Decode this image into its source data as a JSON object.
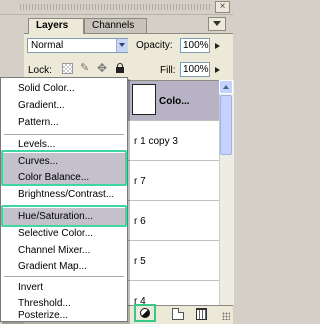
{
  "palette": {
    "close_glyph": "×",
    "tabs": [
      {
        "label": "Layers",
        "active": true
      },
      {
        "label": "Channels",
        "active": false
      }
    ],
    "blend_mode": "Normal",
    "opacity_label": "Opacity:",
    "opacity_value": "100%",
    "lock_label": "Lock:",
    "fill_label": "Fill:",
    "fill_value": "100%"
  },
  "layers": [
    {
      "name": "Colo...",
      "selected": true
    },
    {
      "name": "r 1 copy 3"
    },
    {
      "name": "r 7"
    },
    {
      "name": "r 6"
    },
    {
      "name": "r 5"
    },
    {
      "name": "r 4"
    }
  ],
  "menu": {
    "groups": [
      [
        "Solid Color...",
        "Gradient...",
        "Pattern..."
      ],
      [
        "Levels...",
        "Curves...",
        "Color Balance...",
        "Brightness/Contrast..."
      ],
      [
        "Hue/Saturation...",
        "Selective Color...",
        "Channel Mixer...",
        "Gradient Map..."
      ],
      [
        "Invert",
        "Threshold...",
        "Posterize..."
      ]
    ],
    "highlighted": [
      "Curves...",
      "Color Balance...",
      "Hue/Saturation..."
    ]
  },
  "icons": {
    "lock_transparent": "checker-icon",
    "lock_paint": "brush-icon",
    "lock_move": "move-icon",
    "lock_all": "lock-icon",
    "adjustment_layer": "half-circle-icon",
    "new_layer": "new-layer-icon",
    "delete": "trash-icon"
  },
  "colors": {
    "highlight_border": "#3fd7a0",
    "menu_highlight": "#c4c0cc",
    "selected_layer": "#b7b3c4"
  }
}
